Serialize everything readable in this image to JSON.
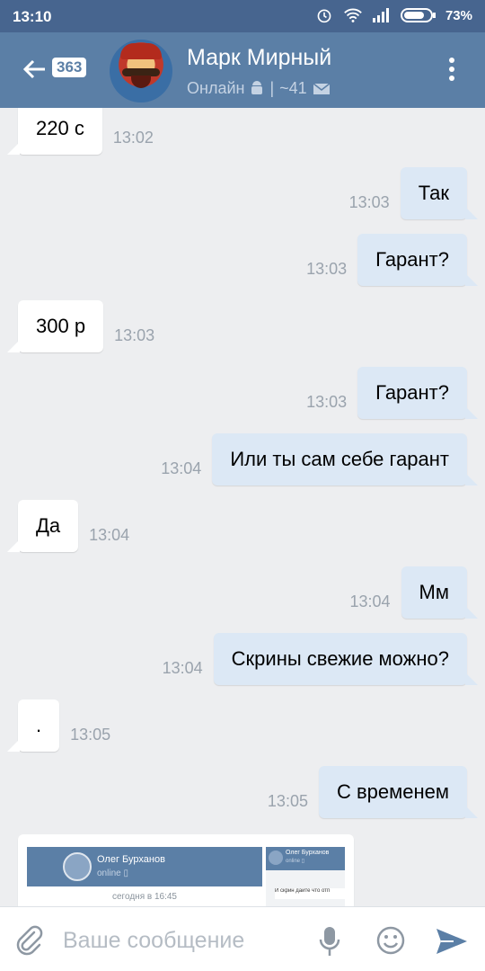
{
  "status_bar": {
    "time": "13:10",
    "battery": "73%"
  },
  "header": {
    "unread_count": "363",
    "contact_name": "Марк Мирный",
    "status_text": "Онлайн",
    "separator": "|",
    "id_text": "~41"
  },
  "messages": [
    {
      "dir": "in",
      "text": "220 с",
      "time": "13:02"
    },
    {
      "dir": "out",
      "text": "Так",
      "time": "13:03"
    },
    {
      "dir": "out",
      "text": "Гарант?",
      "time": "13:03"
    },
    {
      "dir": "in",
      "text": "300 р",
      "time": "13:03"
    },
    {
      "dir": "out",
      "text": "Гарант?",
      "time": "13:03"
    },
    {
      "dir": "out",
      "text": "Или ты сам себе гарант",
      "time": "13:04"
    },
    {
      "dir": "in",
      "text": "Да",
      "time": "13:04"
    },
    {
      "dir": "out",
      "text": "Мм",
      "time": "13:04"
    },
    {
      "dir": "out",
      "text": "Скрины свежие можно?",
      "time": "13:04"
    },
    {
      "dir": "in",
      "text": ".",
      "time": "13:05"
    },
    {
      "dir": "out",
      "text": "С временем",
      "time": "13:05"
    }
  ],
  "attachment": {
    "shot1_name": "Олег Бурханов",
    "shot1_status": "online ▯",
    "shot1_date": "сегодня в 16:45",
    "shot2_name": "Олег Бурханов",
    "shot2_status": "online ▯",
    "shot2_text": "И скрин дайте что отп"
  },
  "input": {
    "placeholder": "Ваше сообщение"
  },
  "colors": {
    "header": "#5b7fa6",
    "statusbar": "#47658f",
    "incoming": "#ffffff",
    "outgoing": "#dce8f5",
    "background": "#edeef0"
  }
}
